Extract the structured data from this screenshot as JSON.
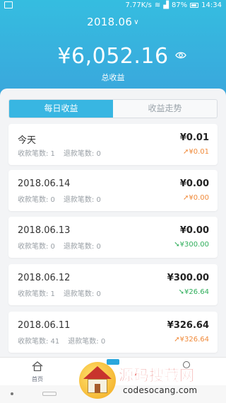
{
  "status_bar": {
    "network_speed": "7.77K/s",
    "battery": "87%",
    "time": "14:34"
  },
  "header": {
    "month": "2018.06",
    "total_amount": "¥6,052.16",
    "total_label": "总收益"
  },
  "tabs": [
    {
      "label": "每日收益",
      "active": true
    },
    {
      "label": "收益走势",
      "active": false
    }
  ],
  "days": [
    {
      "date": "今天",
      "receive_label": "收款笔数: 1",
      "refund_label": "退款笔数: 0",
      "amount": "¥0.01",
      "trend_arrow": "➚",
      "trend": "¥0.01",
      "trend_dir": "up"
    },
    {
      "date": "2018.06.14",
      "receive_label": "收款笔数: 0",
      "refund_label": "退款笔数: 0",
      "amount": "¥0.00",
      "trend_arrow": "➚",
      "trend": "¥0.00",
      "trend_dir": "up"
    },
    {
      "date": "2018.06.13",
      "receive_label": "收款笔数: 0",
      "refund_label": "退款笔数: 0",
      "amount": "¥0.00",
      "trend_arrow": "➘",
      "trend": "¥300.00",
      "trend_dir": "down"
    },
    {
      "date": "2018.06.12",
      "receive_label": "收款笔数: 1",
      "refund_label": "退款笔数: 0",
      "amount": "¥300.00",
      "trend_arrow": "➘",
      "trend": "¥26.64",
      "trend_dir": "down"
    },
    {
      "date": "2018.06.11",
      "receive_label": "收款笔数: 41",
      "refund_label": "退款笔数: 0",
      "amount": "¥326.64",
      "trend_arrow": "➚",
      "trend": "¥326.64",
      "trend_dir": "up"
    }
  ],
  "bottom_nav": {
    "home_label": "首页"
  },
  "watermark": {
    "title": "源码搜藏网",
    "url": "codesocang.com"
  },
  "colors": {
    "header_start": "#35bde0",
    "header_end": "#3aa6dc",
    "up": "#f08a3a",
    "down": "#2fae5b",
    "tab_active": "#38b6e2"
  }
}
